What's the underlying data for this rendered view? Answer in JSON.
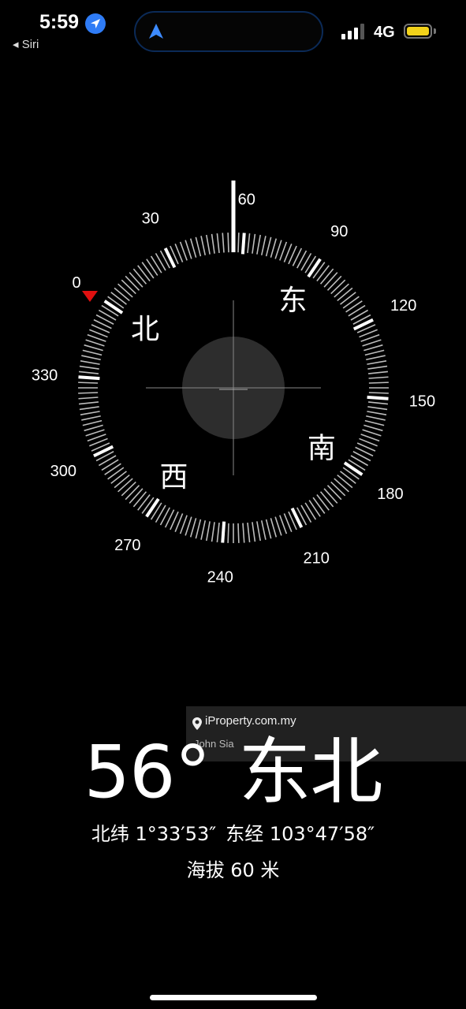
{
  "status_bar": {
    "time": "5:59",
    "location_icon": "location-arrow-icon",
    "back_label": "◂ Siri",
    "network": "4G",
    "battery_color": "#f2d21a",
    "signal_icon": "cellular-signal-icon",
    "navigation_icon": "navigation-arrow-icon",
    "navigation_icon_color": "#3d8bff"
  },
  "compass": {
    "degree_labels": [
      "0",
      "30",
      "60",
      "90",
      "120",
      "150",
      "180",
      "210",
      "240",
      "270",
      "300",
      "330"
    ],
    "cardinals": {
      "north": "北",
      "east": "东",
      "south": "南",
      "west": "西"
    },
    "marker_color": "#e01010",
    "center_circle_color": "#2d2d2d"
  },
  "watermark": {
    "brand": "iProperty.com.my",
    "owner": "John Sia"
  },
  "readout": {
    "heading": "56°",
    "direction": "东北",
    "latitude": "北纬 1°33′53″",
    "longitude": "东经 103°47′58″",
    "altitude": "海拔 60 米"
  }
}
